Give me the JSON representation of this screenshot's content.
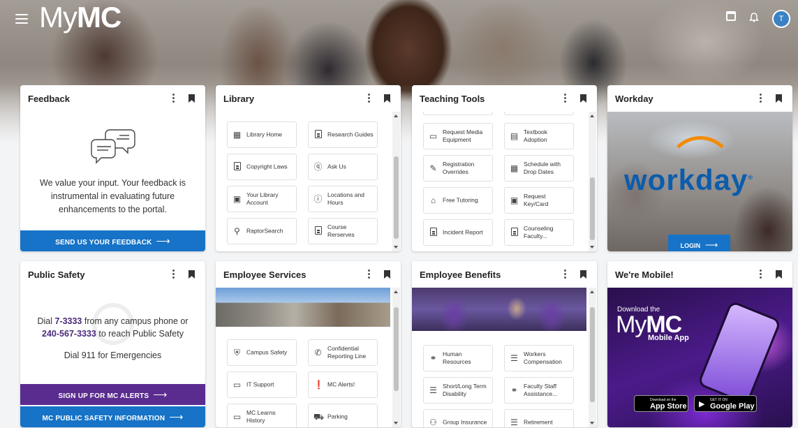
{
  "header": {
    "logo_my": "My",
    "logo_mc": "MC",
    "avatar_initial": "T"
  },
  "feedback": {
    "title": "Feedback",
    "message": "We value your input. Your feedback is instrumental in evaluating future enhancements to the portal.",
    "cta": "SEND US YOUR FEEDBACK",
    "cta_color": "#1673c7"
  },
  "library": {
    "title": "Library",
    "links": [
      {
        "label": "Library Home",
        "icon": "building-icon"
      },
      {
        "label": "Research Guides",
        "icon": "document-icon"
      },
      {
        "label": "Copyright Laws",
        "icon": "document-icon"
      },
      {
        "label": "Ask Us",
        "icon": "question-icon"
      },
      {
        "label": "Your Library Account",
        "icon": "id-card-icon"
      },
      {
        "label": "Locations and Hours",
        "icon": "info-icon"
      },
      {
        "label": "RaptorSearch",
        "icon": "search-icon"
      },
      {
        "label": "Course Rerserves",
        "icon": "document-icon"
      }
    ]
  },
  "teaching": {
    "title": "Teaching Tools",
    "links": [
      {
        "label": "Request Media Equipment",
        "icon": "monitor-icon"
      },
      {
        "label": "Textbook Adoption",
        "icon": "book-icon"
      },
      {
        "label": "Registration Overrides",
        "icon": "edit-icon"
      },
      {
        "label": "Schedule with Drop Dates",
        "icon": "calendar-icon"
      },
      {
        "label": "Free Tutoring",
        "icon": "school-icon"
      },
      {
        "label": "Request Key/Card",
        "icon": "id-card-icon"
      },
      {
        "label": "Incident Report",
        "icon": "document-icon"
      },
      {
        "label": "Counseling Faculty...",
        "icon": "document-icon"
      }
    ]
  },
  "workday": {
    "title": "Workday",
    "wordmark": "workday",
    "login": "LOGIN"
  },
  "public_safety": {
    "title": "Public Safety",
    "line1_pre": "Dial ",
    "line1_num": "7-3333",
    "line1_post": " from any campus phone or",
    "line2_num": "240-567-3333",
    "line2_post": " to reach Public Safety",
    "line3": "Dial 911 for Emergencies",
    "cta_alerts": "SIGN UP FOR MC ALERTS",
    "cta_info": "MC PUBLIC SAFETY INFORMATION",
    "alerts_color": "#5b2c8f",
    "info_color": "#1673c7"
  },
  "employee_services": {
    "title": "Employee Services",
    "links": [
      {
        "label": "Campus Safety",
        "icon": "safety-icon"
      },
      {
        "label": "Confidential Reporting Line",
        "icon": "phone-icon"
      },
      {
        "label": "IT Support",
        "icon": "laptop-icon"
      },
      {
        "label": "MC Alerts!",
        "icon": "alert-icon"
      },
      {
        "label": "MC Learns History",
        "icon": "monitor-icon"
      },
      {
        "label": "Parking",
        "icon": "car-icon"
      }
    ]
  },
  "employee_benefits": {
    "title": "Employee Benefits",
    "links": [
      {
        "label": "Human Resources",
        "icon": "handshake-icon"
      },
      {
        "label": "Workers Compensation",
        "icon": "list-icon"
      },
      {
        "label": "Short/Long Term Disability",
        "icon": "list-icon"
      },
      {
        "label": "Faculty Staff Assistance...",
        "icon": "handshake-icon"
      },
      {
        "label": "Group Insurance",
        "icon": "group-icon"
      },
      {
        "label": "Retirement",
        "icon": "list-icon"
      }
    ]
  },
  "mobile": {
    "title": "We're Mobile!",
    "download": "Download the",
    "logo_my": "My",
    "logo_mc": "MC",
    "app_label": "Mobile App",
    "appstore_small": "Download on the",
    "appstore_big": "App Store",
    "googleplay_small": "GET IT ON",
    "googleplay_big": "Google Play"
  }
}
